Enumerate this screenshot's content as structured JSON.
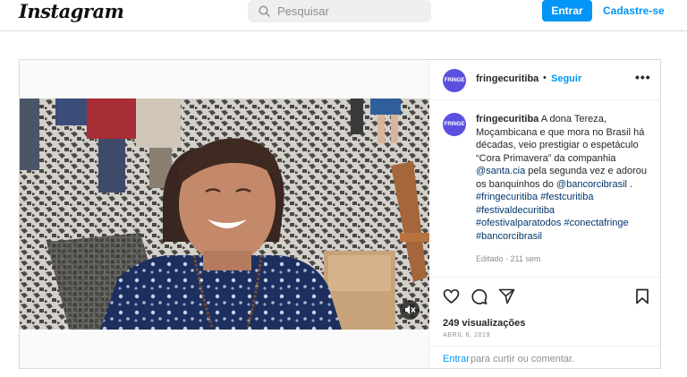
{
  "header": {
    "logo": "Instagram",
    "search_placeholder": "Pesquisar",
    "login_label": "Entrar",
    "signup_label": "Cadastre-se"
  },
  "post": {
    "username": "fringecuritiba",
    "avatar_text": "FRINGE",
    "dot": "•",
    "follow_label": "Seguir",
    "more_icon": "more-options-icon",
    "caption": {
      "username": "fringecuritiba",
      "text_part1": " A dona Tereza, Moçambicana e que mora no Brasil há décadas, veio prestigiar o espetáculo “Cora Primavera” da companhia ",
      "mention1": "@santa.cia",
      "text_part2": " pela segunda vez e adorou os banquinhos do ",
      "mention2": "@bancorcibrasil",
      "text_part3": " .",
      "hashtags": [
        "#fringecuritiba",
        "#festcuritiba",
        "#festivaldecuritiba",
        "#ofestivalparatodos",
        "#conectafringe",
        "#bancorcibrasil"
      ]
    },
    "meta": "Editado · 211 sem",
    "views": "249 visualizações",
    "date": "ABRIL 6, 2019",
    "comment_login": "Entrar",
    "comment_prompt": "para curtir ou comentar.",
    "icons": [
      "heart-icon",
      "comment-icon",
      "share-icon",
      "bookmark-icon",
      "mute-icon"
    ]
  },
  "colors": {
    "accent": "#0095f6",
    "link": "#00376b",
    "avatar": "#5b4fe0"
  }
}
